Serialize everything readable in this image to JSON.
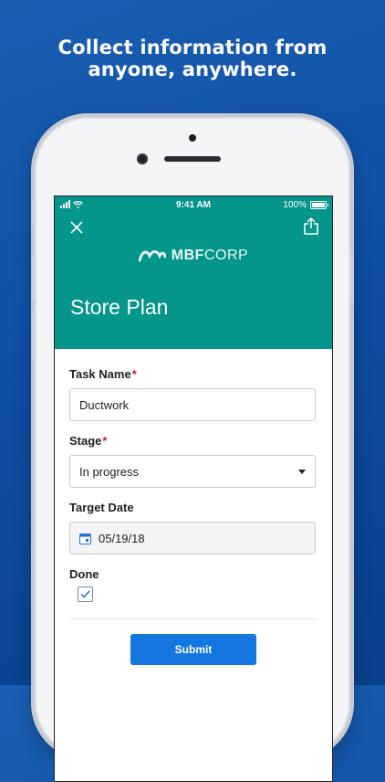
{
  "promo": {
    "headline_line1": "Collect information from",
    "headline_line2": "anyone, anywhere."
  },
  "status_bar": {
    "time": "9:41 AM",
    "battery": "100%"
  },
  "header": {
    "logo_bold": "MBF",
    "logo_light": "CORP",
    "title": "Store Plan",
    "close_icon": "close-icon",
    "share_icon": "share-icon",
    "background_color": "#04968a"
  },
  "form": {
    "task_name": {
      "label": "Task Name",
      "required": "*",
      "value": "Ductwork"
    },
    "stage": {
      "label": "Stage",
      "required": "*",
      "value": "In progress"
    },
    "target_date": {
      "label": "Target Date",
      "value": "05/19/18"
    },
    "done": {
      "label": "Done",
      "checked": true
    },
    "submit_label": "Submit",
    "accent_color": "#1476e0",
    "required_color": "#d21c3c"
  }
}
